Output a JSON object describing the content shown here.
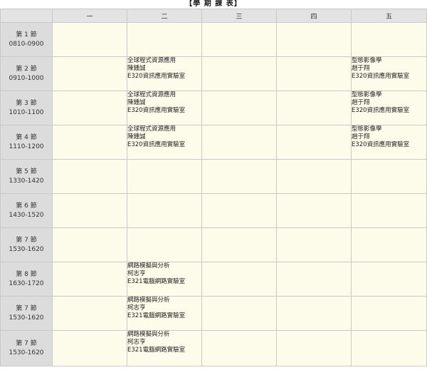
{
  "title": "【學 期 課 表】",
  "days": [
    "一",
    "二",
    "三",
    "四",
    "五"
  ],
  "periods": [
    {
      "label": "第 1 節",
      "time": "0810-0900"
    },
    {
      "label": "第 2 節",
      "time": "0910-1000"
    },
    {
      "label": "第 3 節",
      "time": "1010-1100"
    },
    {
      "label": "第 4 節",
      "time": "1110-1200"
    },
    {
      "label": "第 5 節",
      "time": "1330-1420"
    },
    {
      "label": "第 6 節",
      "time": "1430-1520"
    },
    {
      "label": "第 7 節",
      "time": "1530-1620"
    },
    {
      "label": "第 8 節",
      "time": "1630-1720"
    },
    {
      "label": "第 7 節",
      "time": "1530-1620"
    },
    {
      "label": "第 7 節",
      "time": "1530-1620"
    }
  ],
  "courses": {
    "c_global": {
      "name": "全球程式資源應用",
      "teacher": "陳鍾誠",
      "room": "E320資訊應用實驗室"
    },
    "c_image": {
      "name": "型態影像學",
      "teacher": "趙于翔",
      "room": "E320資訊應用實驗室"
    },
    "c_net": {
      "name": "網路模擬與分析",
      "teacher": "柯志亨",
      "room": "E321電腦網路實驗室"
    }
  },
  "grid": [
    [
      null,
      null,
      null,
      null,
      null
    ],
    [
      null,
      "c_global",
      null,
      null,
      "c_image"
    ],
    [
      null,
      "c_global",
      null,
      null,
      "c_image"
    ],
    [
      null,
      "c_global",
      null,
      null,
      "c_image"
    ],
    [
      null,
      null,
      null,
      null,
      null
    ],
    [
      null,
      null,
      null,
      null,
      null
    ],
    [
      null,
      null,
      null,
      null,
      null
    ],
    [
      null,
      "c_net",
      null,
      null,
      null
    ],
    [
      null,
      "c_net",
      null,
      null,
      null
    ],
    [
      null,
      "c_net",
      null,
      null,
      null
    ]
  ]
}
